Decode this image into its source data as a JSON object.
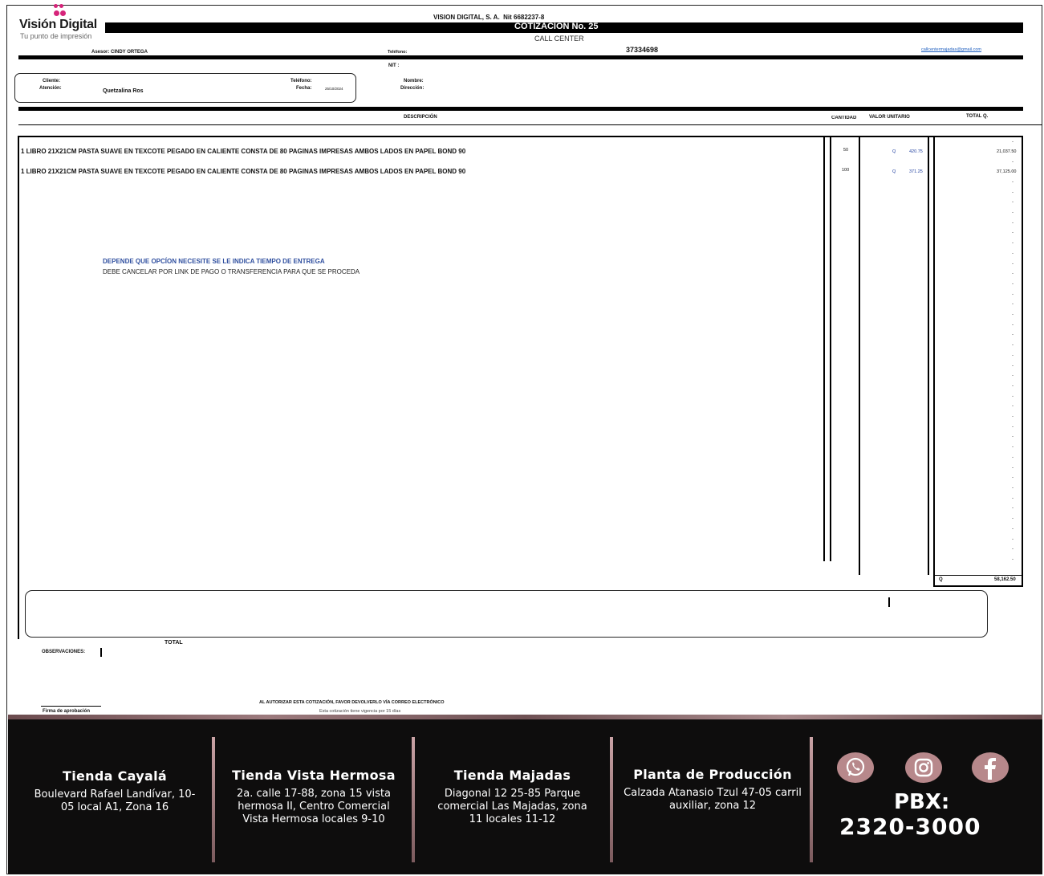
{
  "brand": {
    "name": "Visión Digital",
    "tagline": "Tu punto de impresión",
    "logo_icon": "dots-logo-icon",
    "accent": "#d6247a"
  },
  "header": {
    "company_line": "VISION DIGITAL, S. A.  Nit 6682237-8",
    "quote_title": "COTIZACION No. 25",
    "department": "CALL CENTER",
    "advisor": "Asesor: CINDY ORTEGA",
    "phone_label": "Teléfono:",
    "phone_value": "37334698",
    "email": "callcentermajadas@gmail.com",
    "nit_label": "NIT :"
  },
  "client": {
    "cliente_label": "Cliente:",
    "atencion_label": "Atención:",
    "atencion_value": "Quetzalina Ros",
    "telefono_label": "Teléfono:",
    "fecha_label": "Fecha:",
    "fecha_value": "25/10/2024",
    "nombre_label": "Nombre:",
    "direccion_label": "Dirección:"
  },
  "table": {
    "headers": {
      "descripcion": "DESCRIPCIÓN",
      "cantidad": "CANTIDAD",
      "valor_unitario": "VALOR UNITARIO",
      "total": "TOTAL Q."
    },
    "rows": [
      {
        "description": "1 LIBRO 21X21CM PASTA SUAVE EN TEXCOTE PEGADO EN CALIENTE CONSTA DE 80 PAGINAS IMPRESAS AMBOS LADOS EN PAPEL BOND 90",
        "qty": "50",
        "currency": "Q",
        "unit": "420.75",
        "total": "21,037.50"
      },
      {
        "description": "1 LIBRO 21X21CM PASTA SUAVE EN TEXCOTE PEGADO EN CALIENTE CONSTA DE 80 PAGINAS IMPRESAS AMBOS LADOS EN PAPEL BOND 90",
        "qty": "100",
        "currency": "Q",
        "unit": "371.25",
        "total": "37,125.00"
      }
    ],
    "empty_mark": "-",
    "note_1": "DEPENDE QUE OPCÍON NECESITE SE LE INDICA TIEMPO DE ENTREGA",
    "note_2": "DEBE CANCELAR POR LINK DE PAGO O TRANSFERENCIA PARA QUE SE PROCEDA",
    "grand_total_currency": "Q",
    "grand_total": "58,162.50"
  },
  "bottom": {
    "total_label": "TOTAL",
    "observaciones_label": "OBSERVACIONES:",
    "firma_label": "Firma de aprobación",
    "autorizar": "AL AUTORIZAR ESTA COTIZACIÓN, FAVOR DEVOLVERLO VÍA CORREO ELECTRÓNICO",
    "vigencia": "Esta cotización tiene vigencia por 15 días"
  },
  "footer": {
    "stores": [
      {
        "title": "Tienda Cayalá",
        "address": "Boulevard Rafael Landívar, 10-05 local A1, Zona 16"
      },
      {
        "title": "Tienda Vista Hermosa",
        "address": "2a. calle 17-88, zona 15 vista hermosa II, Centro Comercial Vista Hermosa locales 9-10"
      },
      {
        "title": "Tienda Majadas",
        "address": "Diagonal 12 25-85 Parque comercial Las Majadas, zona 11 locales 11-12"
      },
      {
        "title": "Planta de Producción",
        "address": "Calzada Atanasio Tzul 47-05 carril auxiliar, zona 12"
      }
    ],
    "social_icons": [
      "whatsapp-icon",
      "instagram-icon",
      "facebook-icon"
    ],
    "pbx_label": "PBX:",
    "pbx_number": "2320-3000",
    "background": "#0e0d0d",
    "accent": "#b7888b"
  }
}
